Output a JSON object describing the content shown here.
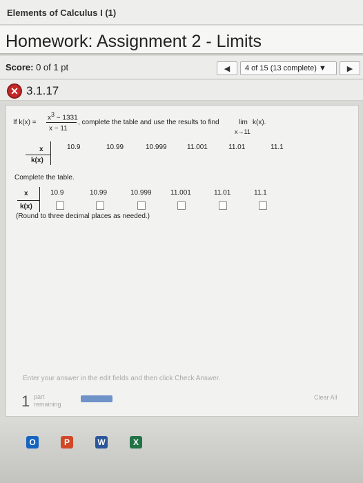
{
  "window_title": "Elements of Calculus I (1)",
  "page_title": "Homework: Assignment 2 - Limits",
  "score": {
    "label": "Score:",
    "value": "0 of 1 pt"
  },
  "nav": {
    "prev_icon": "triangle-left",
    "dropdown_text": "4 of 15 (13 complete) ▼",
    "next_icon": "triangle-right"
  },
  "question": {
    "status_icon": "x-circle-icon",
    "number": "3.1.17"
  },
  "prompt": {
    "prefix": "If k(x) =",
    "numerator_base": "x",
    "numerator_exp": "3",
    "numerator_rest": " − 1331",
    "denominator": "x − 11",
    "suffix": ", complete the table and use the results to find",
    "lim_word": "lim",
    "lim_expr": "k(x).",
    "lim_sub": "x→11"
  },
  "given_table": {
    "row_x_label": "x",
    "row_k_label": "k(x)",
    "x_values": [
      "10.9",
      "10.99",
      "10.999",
      "11.001",
      "11.01",
      "11.1"
    ]
  },
  "instruction": "Complete the table.",
  "answer_table": {
    "row_x_label": "x",
    "row_k_label": "k(x)",
    "x_values": [
      "10.9",
      "10.99",
      "10.999",
      "11.001",
      "11.01",
      "11.1"
    ],
    "k_values": [
      "",
      "",
      "",
      "",
      "",
      ""
    ]
  },
  "rounding_note": "(Round to three decimal places as needed.)",
  "footer": {
    "hint": "Enter your answer in the edit fields and then click Check Answer.",
    "parts_count": "1",
    "parts_label_1": "part",
    "parts_label_2": "remaining",
    "clear_all": "Clear All"
  },
  "taskbar": {
    "icons": [
      {
        "name": "outlook-icon",
        "letter": "O",
        "color": "#1565c0"
      },
      {
        "name": "powerpoint-icon",
        "letter": "P",
        "color": "#d24726"
      },
      {
        "name": "word-icon",
        "letter": "W",
        "color": "#2b579a"
      },
      {
        "name": "excel-icon",
        "letter": "X",
        "color": "#217346"
      }
    ]
  }
}
